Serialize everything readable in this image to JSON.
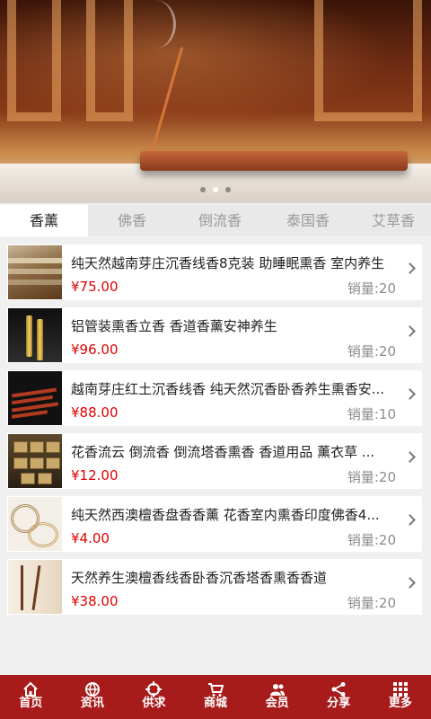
{
  "banner": {
    "slide_count": 3,
    "active_slide": 2
  },
  "tabs": [
    {
      "label": "香薰",
      "active": true
    },
    {
      "label": "佛香",
      "active": false
    },
    {
      "label": "倒流香",
      "active": false
    },
    {
      "label": "泰国香",
      "active": false
    },
    {
      "label": "艾草香",
      "active": false
    }
  ],
  "products": [
    {
      "title": "纯天然越南芽庄沉香线香8克装 助睡眠熏香 室内养生",
      "price": "¥75.00",
      "sales": "销量:20"
    },
    {
      "title": "铝管装熏香立香 香道香薰安神养生",
      "price": "¥96.00",
      "sales": "销量:20"
    },
    {
      "title": "越南芽庄红土沉香线香 纯天然沉香卧香养生熏香安...",
      "price": "¥88.00",
      "sales": "销量:10"
    },
    {
      "title": "花香流云 倒流香 倒流塔香熏香 香道用品 薰衣草 ...",
      "price": "¥12.00",
      "sales": "销量:20"
    },
    {
      "title": "纯天然西澳檀香盘香香薰 花香室内熏香印度佛香4...",
      "price": "¥4.00",
      "sales": "销量:20"
    },
    {
      "title": "天然养生澳檀香线香卧香沉香塔香熏香香道",
      "price": "¥38.00",
      "sales": "销量:20"
    }
  ],
  "nav": [
    {
      "label": "首页",
      "icon": "home-icon"
    },
    {
      "label": "资讯",
      "icon": "globe-icon"
    },
    {
      "label": "供求",
      "icon": "target-icon"
    },
    {
      "label": "商城",
      "icon": "cart-icon"
    },
    {
      "label": "会员",
      "icon": "users-icon"
    },
    {
      "label": "分享",
      "icon": "share-icon"
    },
    {
      "label": "更多",
      "icon": "grid-icon"
    }
  ],
  "colors": {
    "nav_bg": "#a81b1b",
    "price": "#e00000",
    "sales": "#8c8c8c"
  }
}
